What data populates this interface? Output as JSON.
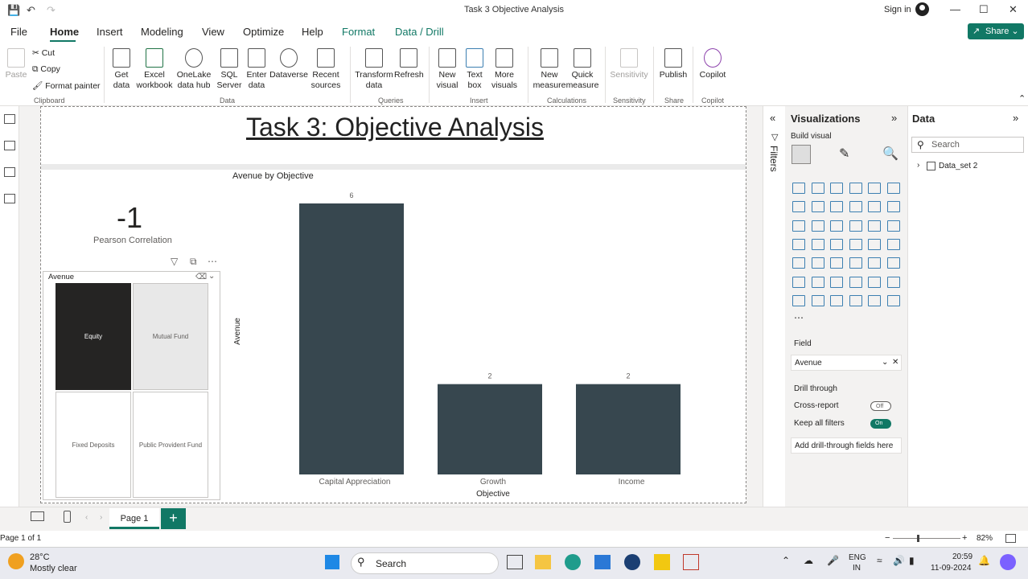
{
  "window": {
    "title": "Task 3 Objective Analysis",
    "sign_in": "Sign in",
    "share_label": "Share"
  },
  "menu": [
    "File",
    "Home",
    "Insert",
    "Modeling",
    "View",
    "Optimize",
    "Help",
    "Format",
    "Data / Drill"
  ],
  "ribbon": {
    "clipboard": {
      "paste": "Paste",
      "cut": "Cut",
      "copy": "Copy",
      "format_painter": "Format painter",
      "group": "Clipboard"
    },
    "data": {
      "get_data": "Get data",
      "excel": "Excel workbook",
      "onelake": "OneLake data hub",
      "sql": "SQL Server",
      "enter": "Enter data",
      "dataverse": "Dataverse",
      "recent": "Recent sources",
      "group": "Data"
    },
    "queries": {
      "transform": "Transform data",
      "refresh": "Refresh",
      "group": "Queries"
    },
    "insert": {
      "new_visual": "New visual",
      "text_box": "Text box",
      "more_visuals": "More visuals",
      "group": "Insert"
    },
    "calculations": {
      "new_measure": "New measure",
      "quick_measure": "Quick measure",
      "group": "Calculations"
    },
    "sensitivity": {
      "label": "Sensitivity",
      "group": "Sensitivity"
    },
    "share": {
      "publish": "Publish",
      "group": "Share"
    },
    "copilot": {
      "label": "Copilot",
      "group": "Copilot"
    }
  },
  "report": {
    "title": "Task 3: Objective Analysis",
    "card": {
      "value": "-1",
      "label": "Pearson Correlation"
    },
    "slicer": {
      "title": "Avenue",
      "tiles": [
        "Equity",
        "Mutual Fund",
        "Fixed Deposits",
        "Public Provident Fund"
      ],
      "selected": "Equity"
    }
  },
  "chart_data": {
    "type": "bar",
    "title": "Avenue by Objective",
    "categories": [
      "Capital Appreciation",
      "Growth",
      "Income"
    ],
    "values": [
      6,
      2,
      2
    ],
    "xlabel": "Objective",
    "ylabel": "Avenue",
    "ylim": [
      0,
      6
    ],
    "bar_color": "#37474f",
    "data_labels": true,
    "grid": false
  },
  "filters_label": "Filters",
  "visualizations": {
    "title": "Visualizations",
    "build_visual": "Build visual",
    "field_label": "Field",
    "field_value": "Avenue",
    "drill_through": "Drill through",
    "cross_report": "Cross-report",
    "cross_report_state": "Off",
    "keep_filters": "Keep all filters",
    "keep_filters_state": "On",
    "add_drill": "Add drill-through fields here"
  },
  "data_pane": {
    "title": "Data",
    "search_placeholder": "Search",
    "dataset": "Data_set 2"
  },
  "pages": {
    "tab": "Page 1",
    "info": "Page 1 of 1",
    "zoom": "82%"
  },
  "taskbar": {
    "temp": "28°C",
    "weather": "Mostly clear",
    "search": "Search",
    "lang1": "ENG",
    "lang2": "IN",
    "time": "20:59",
    "date": "11-09-2024"
  },
  "colors": {
    "accent": "#117865",
    "bar": "#37474f"
  }
}
